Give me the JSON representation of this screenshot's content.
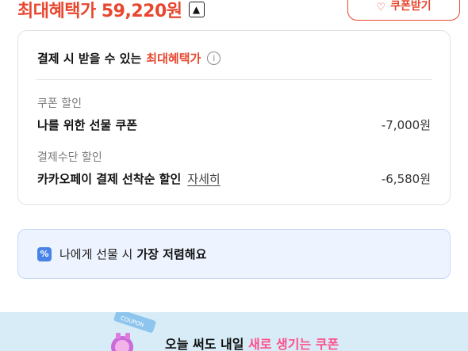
{
  "header": {
    "max_benefit_label": "최대혜택가 59,220원",
    "collapse_icon": "chevron-up-icon",
    "coupon_button_label": "쿠폰받기",
    "accent_color": "#e8462e"
  },
  "benefit_card": {
    "title_prefix": "결제 시 받을 수 있는",
    "title_accent": "최대혜택가",
    "info_icon": "info-icon",
    "coupon_section_label": "쿠폰 할인",
    "coupon_item_name": "나를 위한 선물 쿠폰",
    "coupon_item_amount": "-7,000원",
    "payment_section_label": "결제수단 할인",
    "payment_item_name": "카카오페이 결제 선착순 할인",
    "payment_detail_link": "자세히",
    "payment_item_amount": "-6,580원"
  },
  "gift_bar": {
    "icon": "tag-icon",
    "text_prefix": "나에게 선물 시",
    "text_strong": "가장 저렴해요",
    "background": "#eef4ff"
  },
  "promo": {
    "text_prefix": "오늘 써도 내일",
    "text_accent": "새로 생기는 쿠폰",
    "art_label": "COUPON",
    "background": "#d7ecf7"
  }
}
